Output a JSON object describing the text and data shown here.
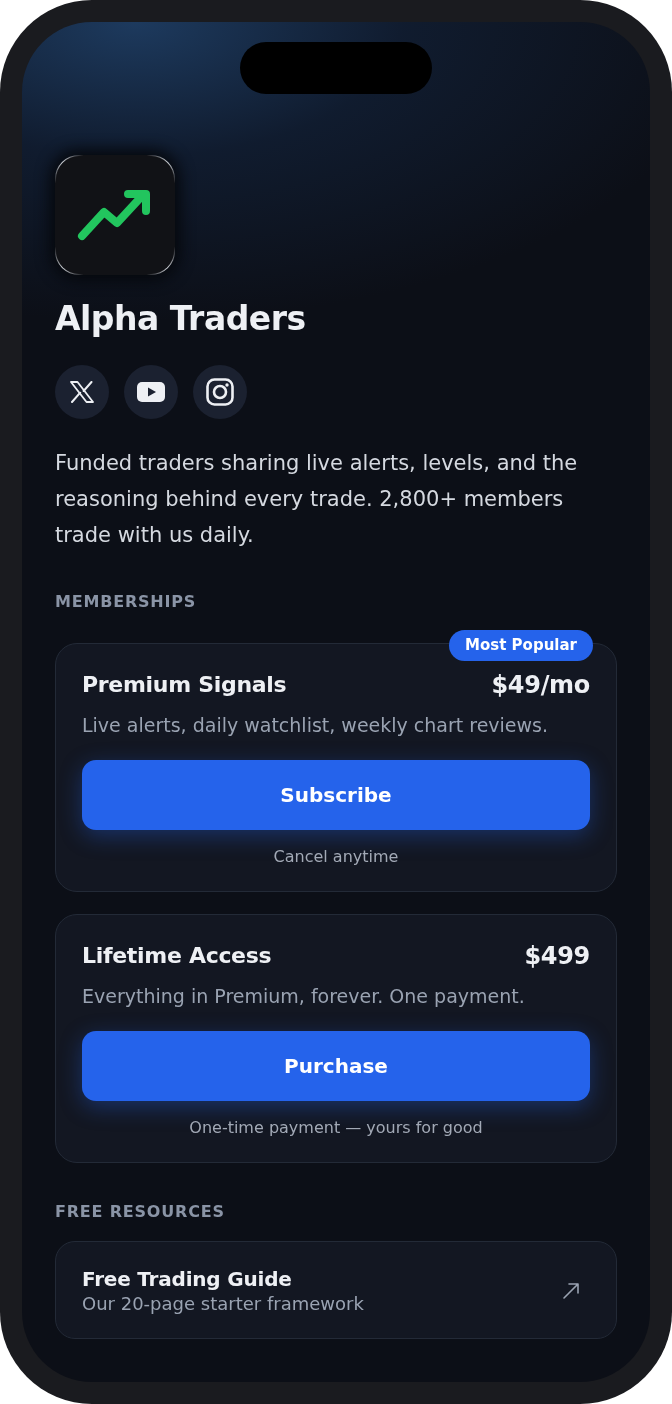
{
  "profile": {
    "name": "Alpha Traders",
    "social_links": [
      {
        "kind": "x"
      },
      {
        "kind": "youtube"
      },
      {
        "kind": "instagram"
      }
    ],
    "description": "Funded traders sharing live alerts, levels, and the reasoning behind every trade. 2,800+ members trade with us daily."
  },
  "memberships": {
    "heading": "MEMBERSHIPS",
    "plans": [
      {
        "name": "Premium Signals",
        "price": "$49/mo",
        "badge": "Most Popular",
        "description": "Live alerts, daily watchlist, weekly chart reviews.",
        "button": "Subscribe",
        "note": "Cancel anytime"
      },
      {
        "name": "Lifetime Access",
        "price": "$499",
        "description": "Everything in Premium, forever. One payment.",
        "button": "Purchase",
        "note": "One-time payment — yours for good"
      }
    ]
  },
  "free_resources": {
    "heading": "FREE RESOURCES",
    "items": [
      {
        "title": "Free Trading Guide",
        "subtitle": "Our 20-page starter framework"
      }
    ]
  }
}
